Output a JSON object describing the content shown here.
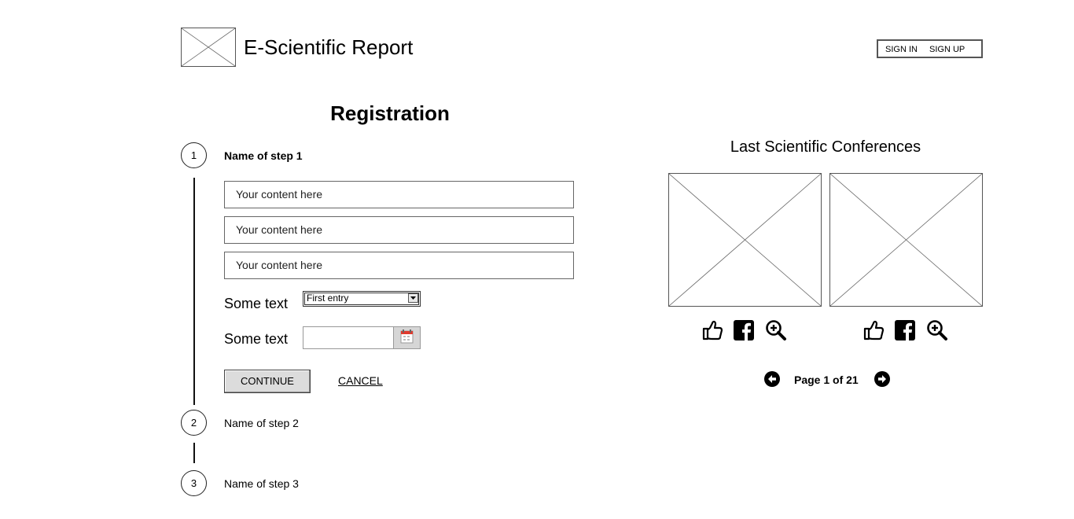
{
  "header": {
    "site_title": "E-Scientific Report",
    "auth": {
      "sign_in": "SIGN IN",
      "sign_up": "SIGN UP"
    }
  },
  "registration": {
    "title": "Registration",
    "steps": [
      {
        "number": "1",
        "label": "Name of step 1"
      },
      {
        "number": "2",
        "label": "Name of step 2"
      },
      {
        "number": "3",
        "label": "Name of step 3"
      }
    ],
    "fields": [
      {
        "value": "Your content here"
      },
      {
        "value": "Your content here"
      },
      {
        "value": "Your content here"
      }
    ],
    "select_label": "Some text",
    "select_value": "First entry",
    "date_label": "Some text",
    "date_value": "",
    "continue_label": "CONTINUE",
    "cancel_label": "CANCEL"
  },
  "conferences": {
    "title": "Last Scientific Conferences",
    "pager": "Page 1 of 21"
  },
  "icons": [
    "logo-placeholder",
    "thumbs-up-icon",
    "facebook-icon",
    "zoom-in-icon",
    "arrow-left-icon",
    "arrow-right-icon",
    "calendar-icon"
  ]
}
